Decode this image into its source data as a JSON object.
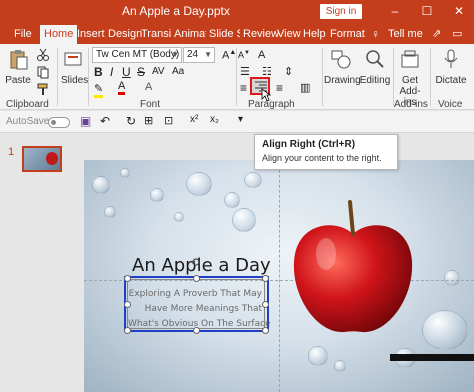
{
  "window": {
    "title": "An Apple a Day.pptx",
    "signin_label": "Sign in",
    "minimize_glyph": "–",
    "maximize_glyph": "☐",
    "close_glyph": "✕"
  },
  "tabs": [
    "File",
    "Home",
    "Insert",
    "Design",
    "Transiti",
    "Animat",
    "Slide Sl",
    "Review",
    "View",
    "Help",
    "Format",
    "Tell me"
  ],
  "active_tab": "Home",
  "ribbon": {
    "clipboard": {
      "paste_label": "Paste",
      "group_label": "Clipboard"
    },
    "slides": {
      "slides_label": "Slides"
    },
    "font": {
      "font_name": "Tw Cen MT (Body)",
      "font_size": "24",
      "group_label": "Font"
    },
    "paragraph": {
      "group_label": "Paragraph"
    },
    "drawing_label": "Drawing",
    "editing_label": "Editing",
    "addins": {
      "get_label": "Get",
      "addins_label": "Add-ins",
      "group_label": "Add-ins"
    },
    "voice": {
      "dictate_label": "Dictate",
      "group_label": "Voice"
    }
  },
  "qat": {
    "autosave_label": "AutoSave"
  },
  "thumbnail": {
    "slide_number": "1"
  },
  "tooltip": {
    "title": "Align Right (Ctrl+R)",
    "description": "Align your content to the right."
  },
  "slide": {
    "title": "An Apple a Day",
    "body_lines": [
      "Exploring A Proverb That May",
      "Have More Meanings That",
      "What's Obvious On The Surface"
    ]
  },
  "colors": {
    "accent": "#c43e1c",
    "selection": "#1f3fc4"
  }
}
